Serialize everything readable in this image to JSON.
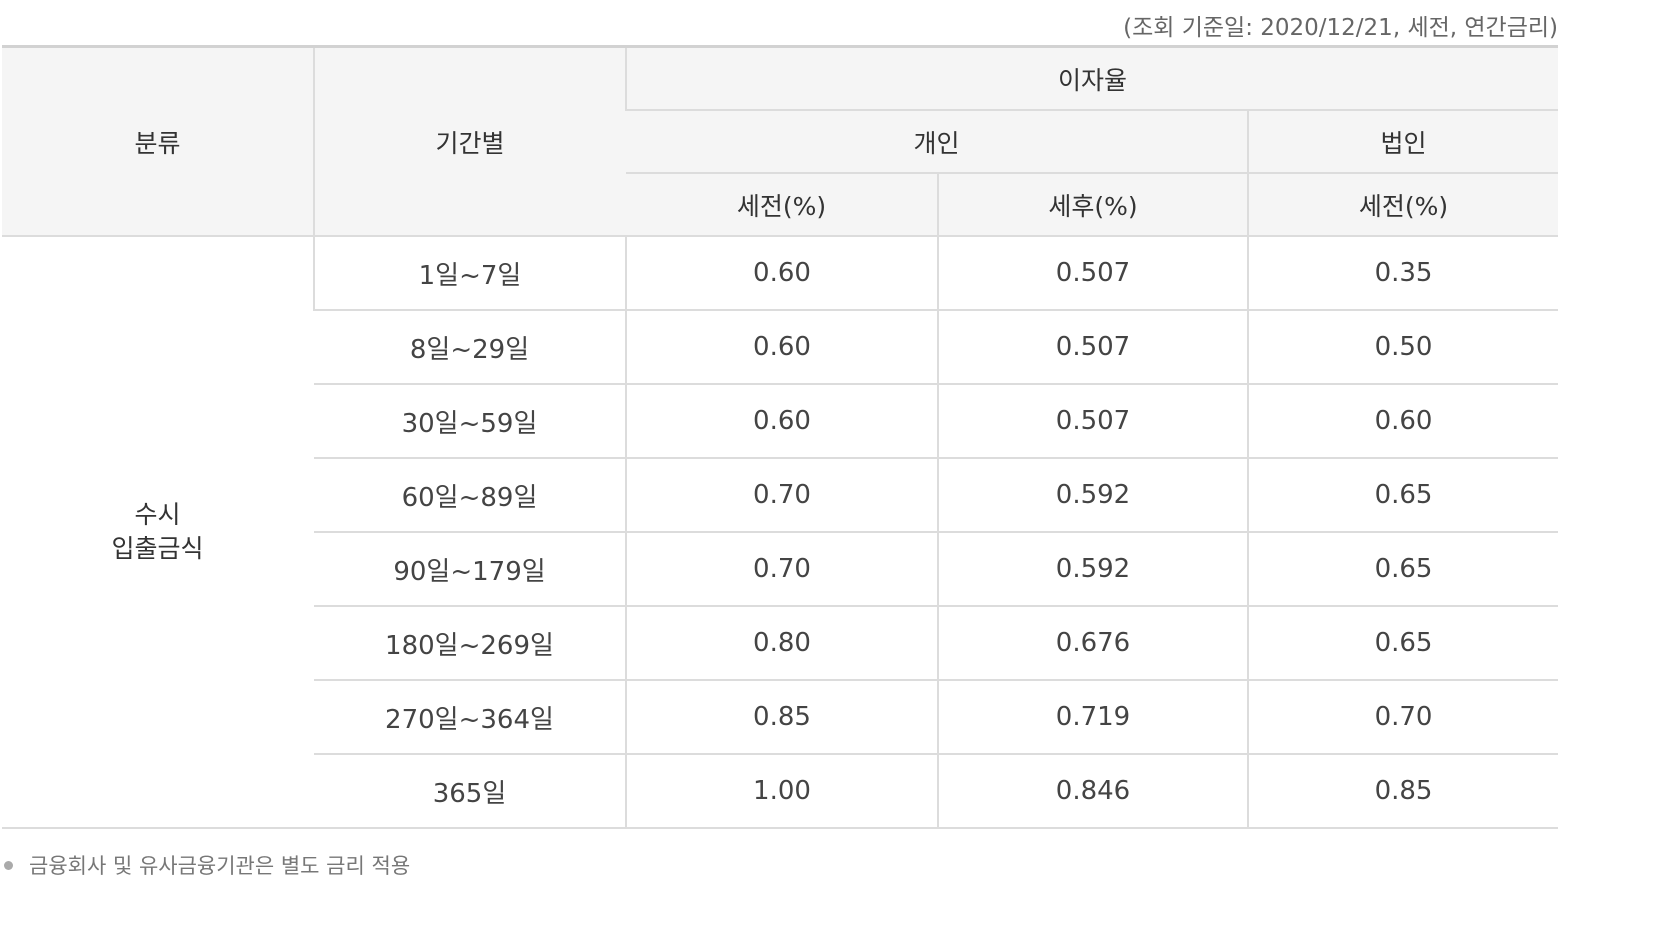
{
  "caption": "(조회 기준일: 2020/12/21, 세전, 연간금리)",
  "headers": {
    "category": "분류",
    "period": "기간별",
    "rate": "이자율",
    "individual": "개인",
    "corporate": "법인",
    "individual_pretax": "세전(%)",
    "individual_aftertax": "세후(%)",
    "corporate_pretax": "세전(%)"
  },
  "category_lines": [
    "수시",
    "입출금식"
  ],
  "rows": [
    {
      "period": "1일~7일",
      "pretax": "0.60",
      "aftertax": "0.507",
      "corp_pretax": "0.35"
    },
    {
      "period": "8일~29일",
      "pretax": "0.60",
      "aftertax": "0.507",
      "corp_pretax": "0.50"
    },
    {
      "period": "30일~59일",
      "pretax": "0.60",
      "aftertax": "0.507",
      "corp_pretax": "0.60"
    },
    {
      "period": "60일~89일",
      "pretax": "0.70",
      "aftertax": "0.592",
      "corp_pretax": "0.65"
    },
    {
      "period": "90일~179일",
      "pretax": "0.70",
      "aftertax": "0.592",
      "corp_pretax": "0.65"
    },
    {
      "period": "180일~269일",
      "pretax": "0.80",
      "aftertax": "0.676",
      "corp_pretax": "0.65"
    },
    {
      "period": "270일~364일",
      "pretax": "0.85",
      "aftertax": "0.719",
      "corp_pretax": "0.70"
    },
    {
      "period": "365일",
      "pretax": "1.00",
      "aftertax": "0.846",
      "corp_pretax": "0.85"
    }
  ],
  "note": "금융회사 및 유사금융기관은 별도 금리 적용",
  "colors": {
    "header_bg": "#f5f5f5",
    "border": "#dcdcdc",
    "text": "#333333",
    "caption_text": "#666666"
  }
}
